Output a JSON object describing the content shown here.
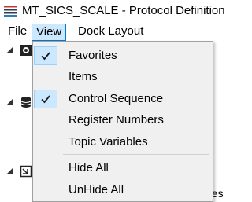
{
  "window": {
    "title": "MT_SICS_SCALE - Protocol Definition",
    "icon": "protocol-app-icon"
  },
  "menubar": {
    "file": "File",
    "view": "View",
    "dock_layout": "Dock Layout"
  },
  "tree": {
    "partial_text": "ges"
  },
  "view_menu": {
    "items": [
      {
        "label": "Favorites",
        "checked": true
      },
      {
        "label": "Items",
        "checked": false
      },
      {
        "label": "Control Sequence",
        "checked": true
      },
      {
        "label": "Register Numbers",
        "checked": false
      },
      {
        "label": "Topic Variables",
        "checked": false
      },
      {
        "label": "Hide All",
        "checked": false
      },
      {
        "label": "UnHide All",
        "checked": false
      }
    ]
  },
  "colors": {
    "menu_highlight": "#cce8ff",
    "menu_highlight_border": "#0078d7",
    "dropdown_bg": "#f0f0f0"
  }
}
